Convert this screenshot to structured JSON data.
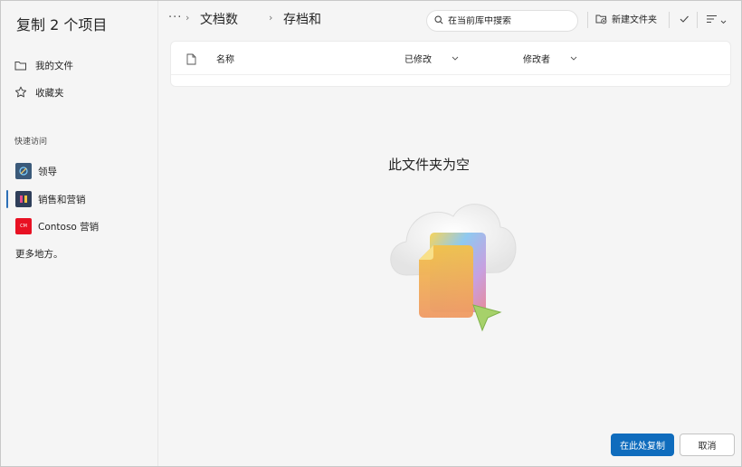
{
  "dialog": {
    "title": "复制 2 个项目"
  },
  "sidebar": {
    "items": [
      {
        "label": "我的文件",
        "icon": "folder-icon"
      },
      {
        "label": "收藏夹",
        "icon": "star-icon"
      }
    ],
    "quick_access_label": "快速访问",
    "sites": [
      {
        "label": "领导",
        "thumb_color": "#3b5a7a"
      },
      {
        "label": "销售和营销",
        "thumb_color": "#2f3f5a",
        "active": true
      },
      {
        "label": "Contoso 营销",
        "thumb_color": "#e81123",
        "thumb_text": "CM"
      }
    ],
    "more_places": "更多地方。"
  },
  "toolbar": {
    "ellipsis": "···",
    "breadcrumb": [
      "文档数",
      "存档和"
    ],
    "search_placeholder": "在当前库中搜索",
    "new_folder_label": "新建文件夹"
  },
  "list": {
    "columns": [
      {
        "label": "名称"
      },
      {
        "label": "已修改"
      },
      {
        "label": "修改者"
      }
    ]
  },
  "empty_state": {
    "message": "此文件夹为空"
  },
  "actions": {
    "copy_here": "在此处复制",
    "cancel": "取消"
  },
  "colors": {
    "accent": "#0f6cbd",
    "active_indicator": "#2c6fb7"
  }
}
